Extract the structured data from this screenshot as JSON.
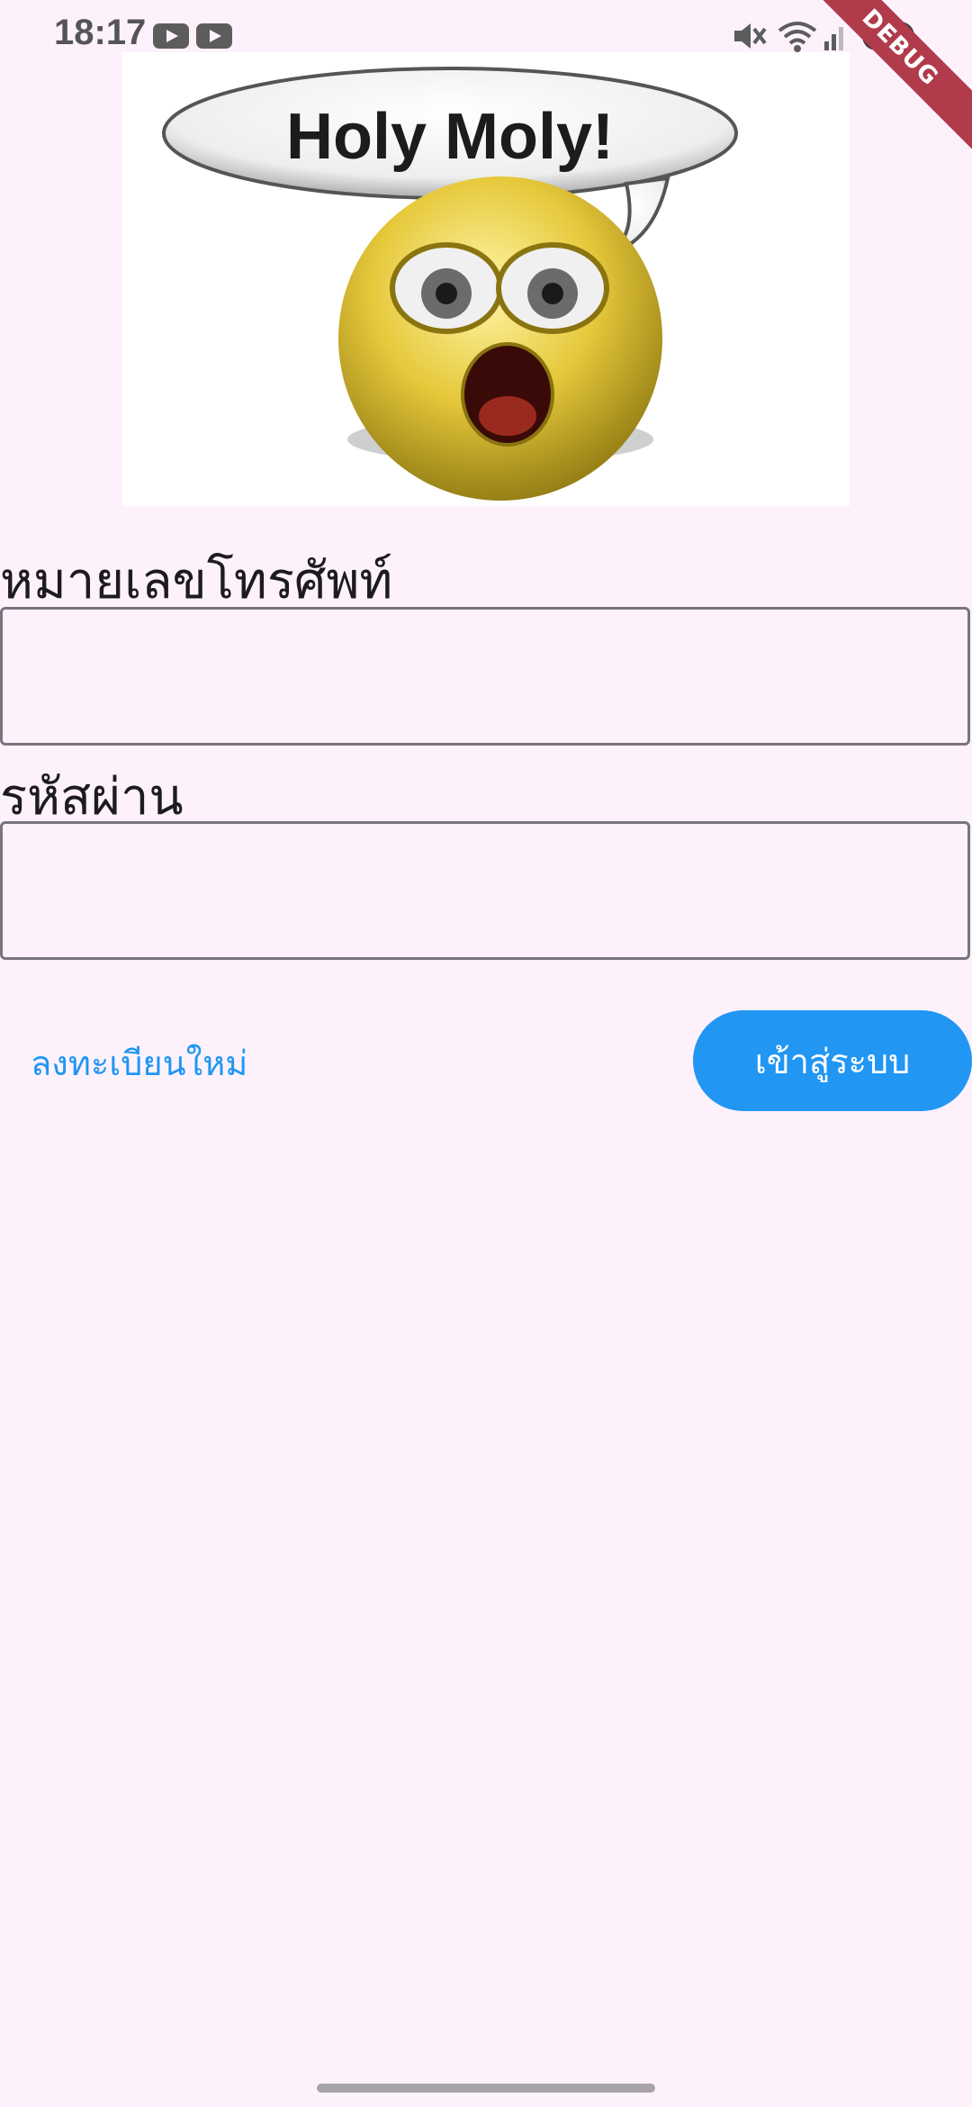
{
  "status_bar": {
    "time": "18:17",
    "icons": [
      "youtube-icon",
      "youtube-icon",
      "mute-icon",
      "wifi-icon",
      "signal-icon",
      "battery-icon"
    ],
    "debug_label": "DEBUG"
  },
  "hero_image": {
    "caption_text": "Holy Moly!",
    "description": "surprised-emoji-icon"
  },
  "form": {
    "phone_label": "หมายเลขโทรศัพท์",
    "phone_value": "",
    "password_label": "รหัสผ่าน",
    "password_value": ""
  },
  "actions": {
    "register_label": "ลงทะเบียนใหม่",
    "login_label": "เข้าสู่ระบบ"
  },
  "colors": {
    "background": "#fdf2fc",
    "accent": "#2196f3",
    "debug": "#b13b4b"
  }
}
